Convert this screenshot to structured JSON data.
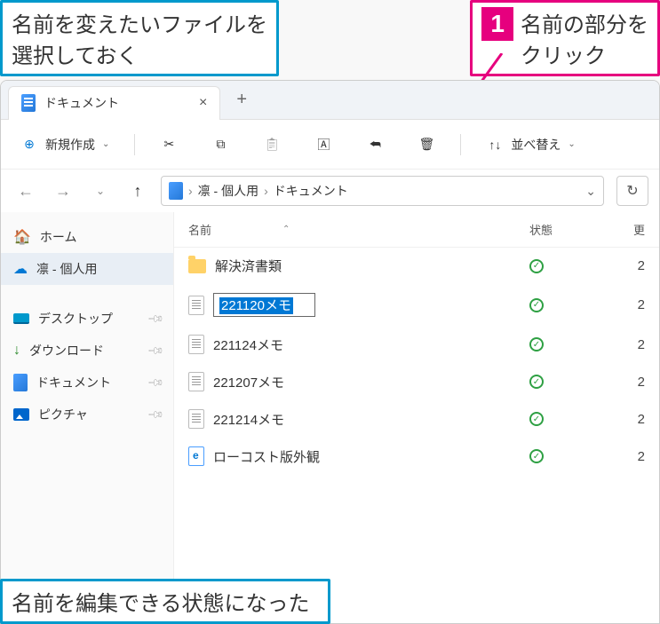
{
  "callouts": {
    "top_left_line1": "名前を変えたいファイルを",
    "top_left_line2": "選択しておく",
    "top_right_num": "1",
    "top_right_line1": "名前の部分を",
    "top_right_line2": "クリック",
    "bottom": "名前を編集できる状態になった"
  },
  "tab": {
    "title": "ドキュメント"
  },
  "toolbar": {
    "new_label": "新規作成",
    "sort_label": "並べ替え"
  },
  "breadcrumb": {
    "items": [
      "凛 - 個人用",
      "ドキュメント"
    ]
  },
  "sidebar": {
    "home": "ホーム",
    "personal": "凛 - 個人用",
    "desktop": "デスクトップ",
    "downloads": "ダウンロード",
    "documents": "ドキュメント",
    "pictures": "ピクチャ"
  },
  "list": {
    "headers": {
      "name": "名前",
      "status": "状態",
      "modified": "更"
    },
    "rows": [
      {
        "icon": "folder",
        "name": "解決済書類",
        "date": "2"
      },
      {
        "icon": "txt",
        "name": "221120メモ",
        "editing": true,
        "date": "2"
      },
      {
        "icon": "txt",
        "name": "221124メモ",
        "date": "2"
      },
      {
        "icon": "txt",
        "name": "221207メモ",
        "date": "2"
      },
      {
        "icon": "txt",
        "name": "221214メモ",
        "date": "2"
      },
      {
        "icon": "html",
        "name": "ローコスト版外観",
        "date": "2"
      }
    ]
  }
}
